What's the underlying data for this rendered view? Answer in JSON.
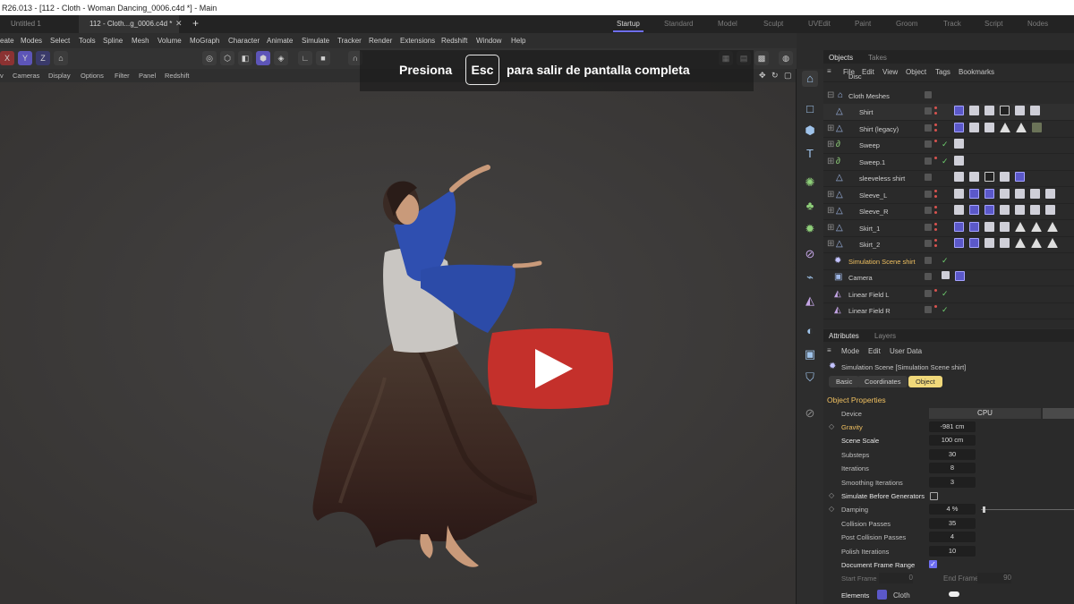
{
  "titlebar": {
    "text": "R26.013 - [112 - Cloth - Woman Dancing_0006.c4d *] - Main"
  },
  "doc_tabs": [
    {
      "label": "Untitled 1"
    },
    {
      "label": "112 - Cloth...g_0006.c4d *"
    }
  ],
  "new_tab": "+",
  "layout_tabs": [
    "Startup",
    "Standard",
    "Model",
    "Sculpt",
    "UVEdit",
    "Paint",
    "Groom",
    "Track",
    "Script",
    "Nodes"
  ],
  "menu": [
    "eate",
    "Modes",
    "Select",
    "Tools",
    "Spline",
    "Mesh",
    "Volume",
    "MoGraph",
    "Character",
    "Animate",
    "Simulate",
    "Tracker",
    "Render",
    "Extensions",
    "Redshift",
    "Window",
    "Help"
  ],
  "toolbar": {
    "x": "X",
    "y": "Y",
    "z": "Z"
  },
  "viewport_menu": [
    "v",
    "Cameras",
    "Display",
    "Options",
    "Filter",
    "Panel",
    "Redshift"
  ],
  "objects_panel": {
    "tabs": [
      "Objects",
      "Takes"
    ],
    "menu": [
      "File",
      "Edit",
      "View",
      "Object",
      "Tags",
      "Bookmarks"
    ],
    "rows": [
      {
        "name": "Disc"
      },
      {
        "name": "Cloth Meshes"
      },
      {
        "name": "Shirt"
      },
      {
        "name": "Shirt (legacy)"
      },
      {
        "name": "Sweep"
      },
      {
        "name": "Sweep.1"
      },
      {
        "name": "sleeveless shirt"
      },
      {
        "name": "Sleeve_L"
      },
      {
        "name": "Sleeve_R"
      },
      {
        "name": "Skirt_1"
      },
      {
        "name": "Skirt_2"
      },
      {
        "name": "Simulation Scene shirt"
      },
      {
        "name": "Camera"
      },
      {
        "name": "Linear Field L"
      },
      {
        "name": "Linear Field R"
      }
    ]
  },
  "attributes_panel": {
    "tabs": [
      "Attributes",
      "Layers"
    ],
    "menu": [
      "Mode",
      "Edit",
      "User Data"
    ],
    "object_title": "Simulation Scene [Simulation Scene shirt]",
    "sub_tabs": [
      "Basic",
      "Coordinates",
      "Object"
    ],
    "section": "Object Properties",
    "device_label": "Device",
    "device_value": "CPU",
    "rows": [
      {
        "label": "Gravity",
        "value": "-981 cm"
      },
      {
        "label": "Scene Scale",
        "value": "100 cm"
      },
      {
        "label": "Substeps",
        "value": "30"
      },
      {
        "label": "Iterations",
        "value": "8"
      },
      {
        "label": "Smoothing Iterations",
        "value": "3"
      }
    ],
    "simulate_before": "Simulate Before Generators",
    "damping": {
      "label": "Damping",
      "value": "4 %"
    },
    "rows2": [
      {
        "label": "Collision Passes",
        "value": "35"
      },
      {
        "label": "Post Collision Passes",
        "value": "4"
      },
      {
        "label": "Polish Iterations",
        "value": "10"
      }
    ],
    "doc_frame_range": "Document Frame Range",
    "start_frame": {
      "label": "Start Frame",
      "value": "0"
    },
    "end_frame": {
      "label": "End Frame",
      "value": "90"
    },
    "elements": {
      "label": "Elements",
      "value": "Cloth"
    }
  },
  "fullscreen_banner": {
    "before": "Presiona",
    "key": "Esc",
    "after": "para salir de pantalla completa"
  },
  "colors": {
    "accent": "#6e6ef0",
    "youtube_red": "#c4302b",
    "tab_active": "#f0d87a"
  }
}
